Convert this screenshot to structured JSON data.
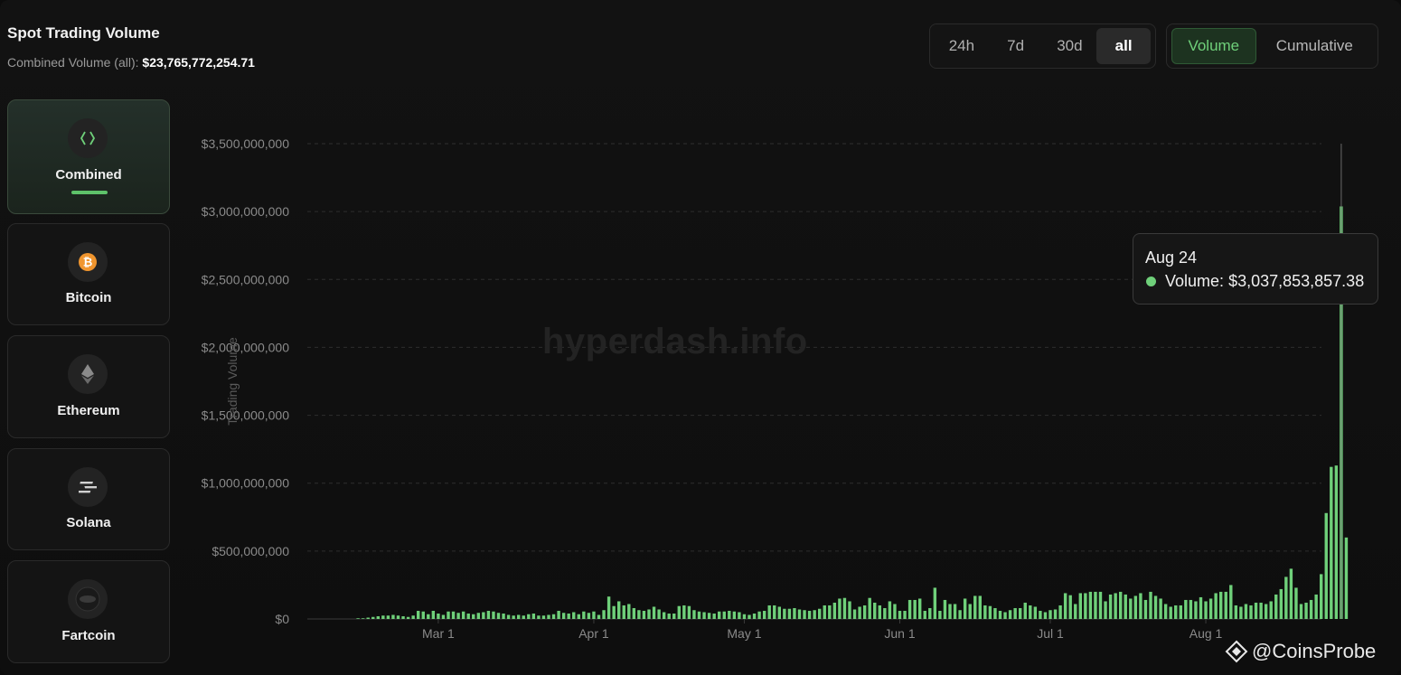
{
  "header": {
    "title": "Spot Trading Volume",
    "subtitle_label": "Combined Volume (all):",
    "subtitle_value": "$23,765,772,254.71"
  },
  "range_buttons": [
    "24h",
    "7d",
    "30d",
    "all"
  ],
  "range_selected": "all",
  "mode_buttons": {
    "volume": "Volume",
    "cumulative": "Cumulative"
  },
  "mode_selected": "Volume",
  "sidebar": {
    "items": [
      {
        "label": "Combined",
        "icon": "code-brackets-icon",
        "active": true
      },
      {
        "label": "Bitcoin",
        "icon": "bitcoin-icon",
        "active": false
      },
      {
        "label": "Ethereum",
        "icon": "ethereum-icon",
        "active": false
      },
      {
        "label": "Solana",
        "icon": "solana-icon",
        "active": false
      },
      {
        "label": "Fartcoin",
        "icon": "fartcoin-icon",
        "active": false
      }
    ]
  },
  "watermark": "hyperdash.info",
  "tooltip": {
    "date": "Aug 24",
    "label": "Volume:",
    "value": "$3,037,853,857.38"
  },
  "brand": {
    "text": "CoinsProbe"
  },
  "colors": {
    "bar": "#6fd07a",
    "accent": "#5ec26a",
    "grid": "#2e2e2e",
    "text_muted": "#8a8a8a"
  },
  "chart_data": {
    "type": "bar",
    "ylabel": "Trading Volume",
    "ylim": [
      0,
      3500000000
    ],
    "y_ticks": [
      "$0",
      "$500,000,000",
      "$1,000,000,000",
      "$1,500,000,000",
      "$2,000,000,000",
      "$2,500,000,000",
      "$3,000,000,000",
      "$3,500,000,000"
    ],
    "y_tick_values": [
      0,
      500000000,
      1000000000,
      1500000000,
      2000000000,
      2500000000,
      3000000000,
      3500000000
    ],
    "x_ticks": [
      "Mar 1",
      "Apr 1",
      "May 1",
      "Jun 1",
      "Jul 1",
      "Aug 1"
    ],
    "x_tick_day_index": [
      18,
      49,
      79,
      110,
      140,
      171
    ],
    "first_bar_day_index": 2,
    "grid": true,
    "series": [
      {
        "name": "Volume",
        "values": [
          5000000,
          5000000,
          10000000,
          15000000,
          20000000,
          25000000,
          25000000,
          30000000,
          25000000,
          20000000,
          15000000,
          25000000,
          60000000,
          55000000,
          35000000,
          60000000,
          40000000,
          30000000,
          55000000,
          55000000,
          45000000,
          55000000,
          40000000,
          35000000,
          45000000,
          50000000,
          60000000,
          55000000,
          45000000,
          40000000,
          30000000,
          25000000,
          30000000,
          25000000,
          35000000,
          40000000,
          25000000,
          25000000,
          30000000,
          35000000,
          60000000,
          45000000,
          40000000,
          50000000,
          35000000,
          55000000,
          45000000,
          55000000,
          30000000,
          65000000,
          165000000,
          95000000,
          130000000,
          100000000,
          110000000,
          80000000,
          65000000,
          60000000,
          70000000,
          90000000,
          70000000,
          50000000,
          40000000,
          40000000,
          95000000,
          100000000,
          95000000,
          65000000,
          55000000,
          50000000,
          45000000,
          40000000,
          55000000,
          55000000,
          60000000,
          55000000,
          50000000,
          35000000,
          30000000,
          40000000,
          55000000,
          60000000,
          100000000,
          100000000,
          90000000,
          75000000,
          75000000,
          80000000,
          70000000,
          65000000,
          60000000,
          65000000,
          75000000,
          100000000,
          100000000,
          120000000,
          150000000,
          155000000,
          130000000,
          70000000,
          90000000,
          100000000,
          155000000,
          120000000,
          100000000,
          80000000,
          130000000,
          110000000,
          60000000,
          60000000,
          140000000,
          140000000,
          150000000,
          60000000,
          80000000,
          230000000,
          60000000,
          140000000,
          110000000,
          110000000,
          65000000,
          150000000,
          110000000,
          170000000,
          170000000,
          100000000,
          95000000,
          80000000,
          60000000,
          50000000,
          65000000,
          80000000,
          80000000,
          120000000,
          100000000,
          90000000,
          60000000,
          50000000,
          65000000,
          70000000,
          100000000,
          190000000,
          175000000,
          110000000,
          190000000,
          190000000,
          200000000,
          200000000,
          200000000,
          130000000,
          180000000,
          190000000,
          200000000,
          180000000,
          150000000,
          170000000,
          190000000,
          140000000,
          200000000,
          170000000,
          150000000,
          110000000,
          90000000,
          100000000,
          100000000,
          140000000,
          140000000,
          130000000,
          160000000,
          130000000,
          150000000,
          190000000,
          200000000,
          200000000,
          250000000,
          100000000,
          90000000,
          110000000,
          100000000,
          120000000,
          120000000,
          110000000,
          130000000,
          180000000,
          220000000,
          310000000,
          370000000,
          230000000,
          110000000,
          120000000,
          140000000,
          180000000,
          330000000,
          780000000,
          1120000000,
          1130000000,
          3037853857,
          600000000
        ]
      }
    ]
  }
}
